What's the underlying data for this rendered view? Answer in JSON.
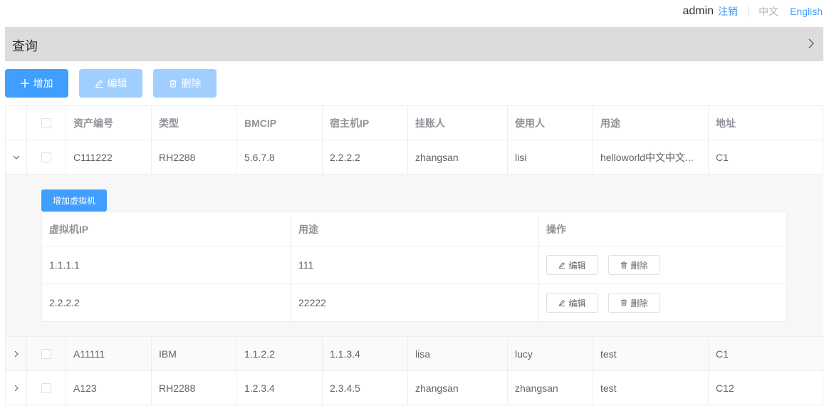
{
  "topbar": {
    "user": "admin",
    "logout": "注销",
    "lang_zh": "中文",
    "lang_en": "English"
  },
  "query": {
    "title": "查询"
  },
  "toolbar": {
    "add_label": "增加",
    "edit_label": "编辑",
    "delete_label": "删除"
  },
  "table": {
    "headers": [
      "资产编号",
      "类型",
      "BMCIP",
      "宿主机IP",
      "挂账人",
      "使用人",
      "用途",
      "地址"
    ],
    "rows": [
      {
        "asset": "C111222",
        "type": "RH2288",
        "bmcip": "5.6.7.8",
        "hostip": "2.2.2.2",
        "owner": "zhangsan",
        "user": "lisi",
        "usage": "helloworld中文中文...",
        "addr": "C1"
      },
      {
        "asset": "A11111",
        "type": "IBM",
        "bmcip": "1.1.2.2",
        "hostip": "1.1.3.4",
        "owner": "lisa",
        "user": "lucy",
        "usage": "test",
        "addr": "C1"
      },
      {
        "asset": "A123",
        "type": "RH2288",
        "bmcip": "1.2.3.4",
        "hostip": "2.3.4.5",
        "owner": "zhangsan",
        "user": "zhangsan",
        "usage": "test",
        "addr": "C12"
      }
    ]
  },
  "subtable": {
    "add_vm_label": "增加虚拟机",
    "headers": [
      "虚拟机IP",
      "用途",
      "操作"
    ],
    "edit_label": "编辑",
    "delete_label": "删除",
    "rows": [
      {
        "ip": "1.1.1.1",
        "usage": "111"
      },
      {
        "ip": "2.2.2.2",
        "usage": "22222"
      }
    ]
  }
}
